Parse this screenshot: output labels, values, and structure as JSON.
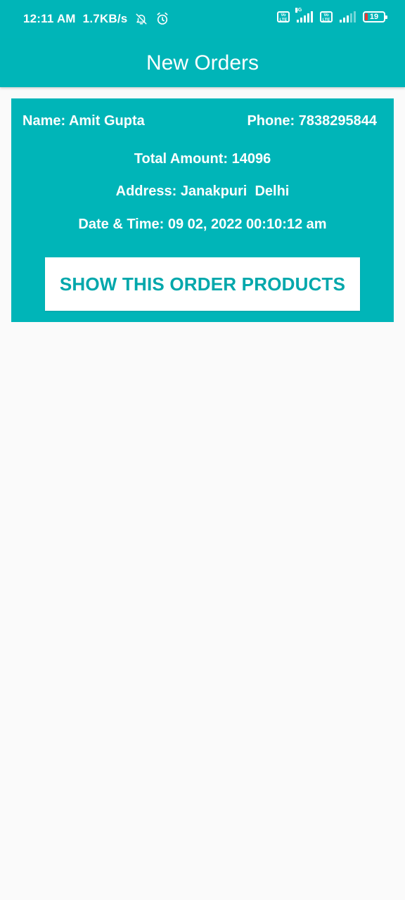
{
  "status_bar": {
    "time": "12:11 AM",
    "net_speed": "1.7KB/s",
    "volte_label": "Vo LTE",
    "network_type": "4G",
    "battery": "19",
    "icons": [
      "bell-off-icon",
      "alarm-icon",
      "volte-icon",
      "signal-icon",
      "battery-icon"
    ]
  },
  "app_bar": {
    "title": "New Orders"
  },
  "orders": [
    {
      "name": "Name: Amit Gupta",
      "phone": "Phone: 7838295844",
      "total_amount": "Total Amount: 14096",
      "address": "Address: Janakpuri  Delhi",
      "datetime": "Date & Time: 09 02, 2022 00:10:12 am",
      "button_label": "SHOW THIS ORDER PRODUCTS"
    }
  ],
  "colors": {
    "primary": "#00b5b8",
    "button_text": "#00a7ab",
    "background": "#fafafa"
  }
}
